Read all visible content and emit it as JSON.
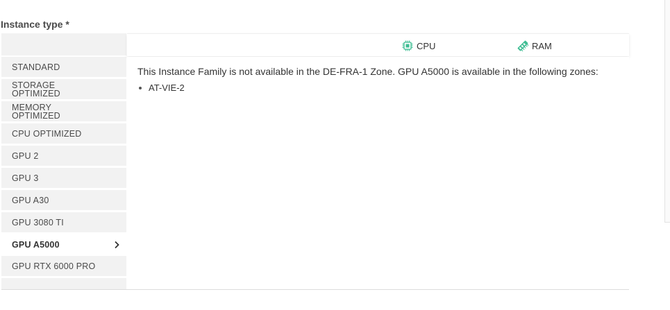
{
  "field": {
    "label": "Instance type *"
  },
  "columns": [
    {
      "label": "CPU",
      "icon": "cpu-chip-icon",
      "color": "#3ebd93"
    },
    {
      "label": "RAM",
      "icon": "ram-stick-icon",
      "color": "#3ebd93"
    }
  ],
  "sidebar": {
    "items": [
      {
        "label": "STANDARD",
        "active": false
      },
      {
        "label": "STORAGE OPTIMIZED",
        "active": false
      },
      {
        "label": "MEMORY OPTIMIZED",
        "active": false
      },
      {
        "label": "CPU OPTIMIZED",
        "active": false
      },
      {
        "label": "GPU 2",
        "active": false
      },
      {
        "label": "GPU 3",
        "active": false
      },
      {
        "label": "GPU A30",
        "active": false
      },
      {
        "label": "GPU 3080 TI",
        "active": false
      },
      {
        "label": "GPU A5000",
        "active": true
      },
      {
        "label": "GPU RTX 6000 PRO",
        "active": false
      }
    ]
  },
  "content": {
    "message": "This Instance Family is not available in the DE-FRA-1 Zone. GPU A5000 is available in the following zones:",
    "zones": [
      "AT-VIE-2"
    ]
  }
}
